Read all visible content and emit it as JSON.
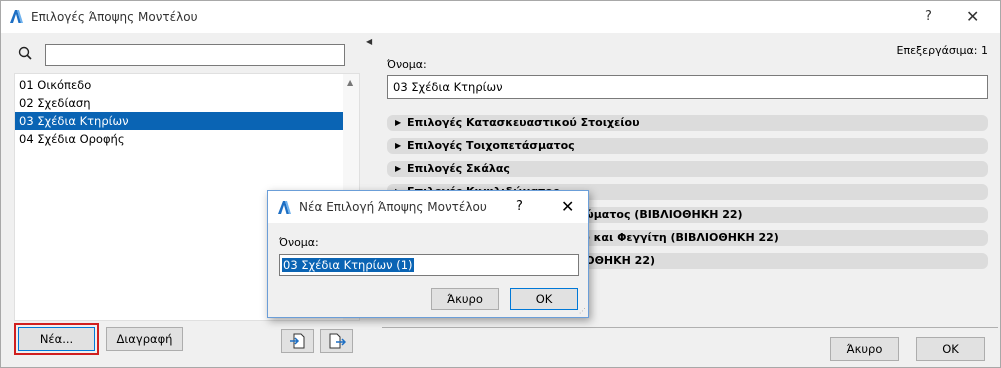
{
  "window": {
    "title": "Επιλογές Άποψης Μοντέλου",
    "help": "?",
    "close": "✕"
  },
  "left": {
    "search": {
      "value": "",
      "placeholder": ""
    },
    "items": [
      {
        "label": "01 Οικόπεδο",
        "selected": false
      },
      {
        "label": "02 Σχεδίαση",
        "selected": false
      },
      {
        "label": "03 Σχέδια Κτηρίων",
        "selected": true
      },
      {
        "label": "04 Σχέδια Οροφής",
        "selected": false
      }
    ],
    "new_button": "Νέα...",
    "delete_button": "Διαγραφή"
  },
  "right": {
    "edit_status": "Επεξεργάσιμα: 1",
    "name_label": "Όνομα:",
    "name_value": "03 Σχέδια Κτηρίων",
    "sections": [
      "Επιλογές Κατασκευαστικού Στοιχείου",
      "Επιλογές Τοιχοπετάσματος",
      "Επιλογές Σκάλας",
      "Επιλογές Κιγκλιδώματος",
      "Επιλογές Σκάλας και Κιγκλιδώματος (ΒΙΒΛΙΟΘΗΚΗ 22)",
      "Επιλογές Πόρτας, Παραθύρου και Φεγγίτη (ΒΙΒΛΙΟΘΗΚΗ 22)",
      "Επιλογές Βιβλιοθήκης (ΒΙΒΛΙΟΘΗΚΗ 22)"
    ],
    "cancel_button": "Άκυρο",
    "ok_button": "OK"
  },
  "dialog": {
    "title": "Νέα Επιλογή Άποψης Μοντέλου",
    "help": "?",
    "close": "✕",
    "name_label": "Όνομα:",
    "name_value": "03 Σχέδια Κτηρίων (1)",
    "cancel_button": "Άκυρο",
    "ok_button": "OK"
  },
  "colors": {
    "selection": "#0a64b4",
    "highlight_border": "#d01f1f",
    "default_button_border": "#0078d7"
  }
}
